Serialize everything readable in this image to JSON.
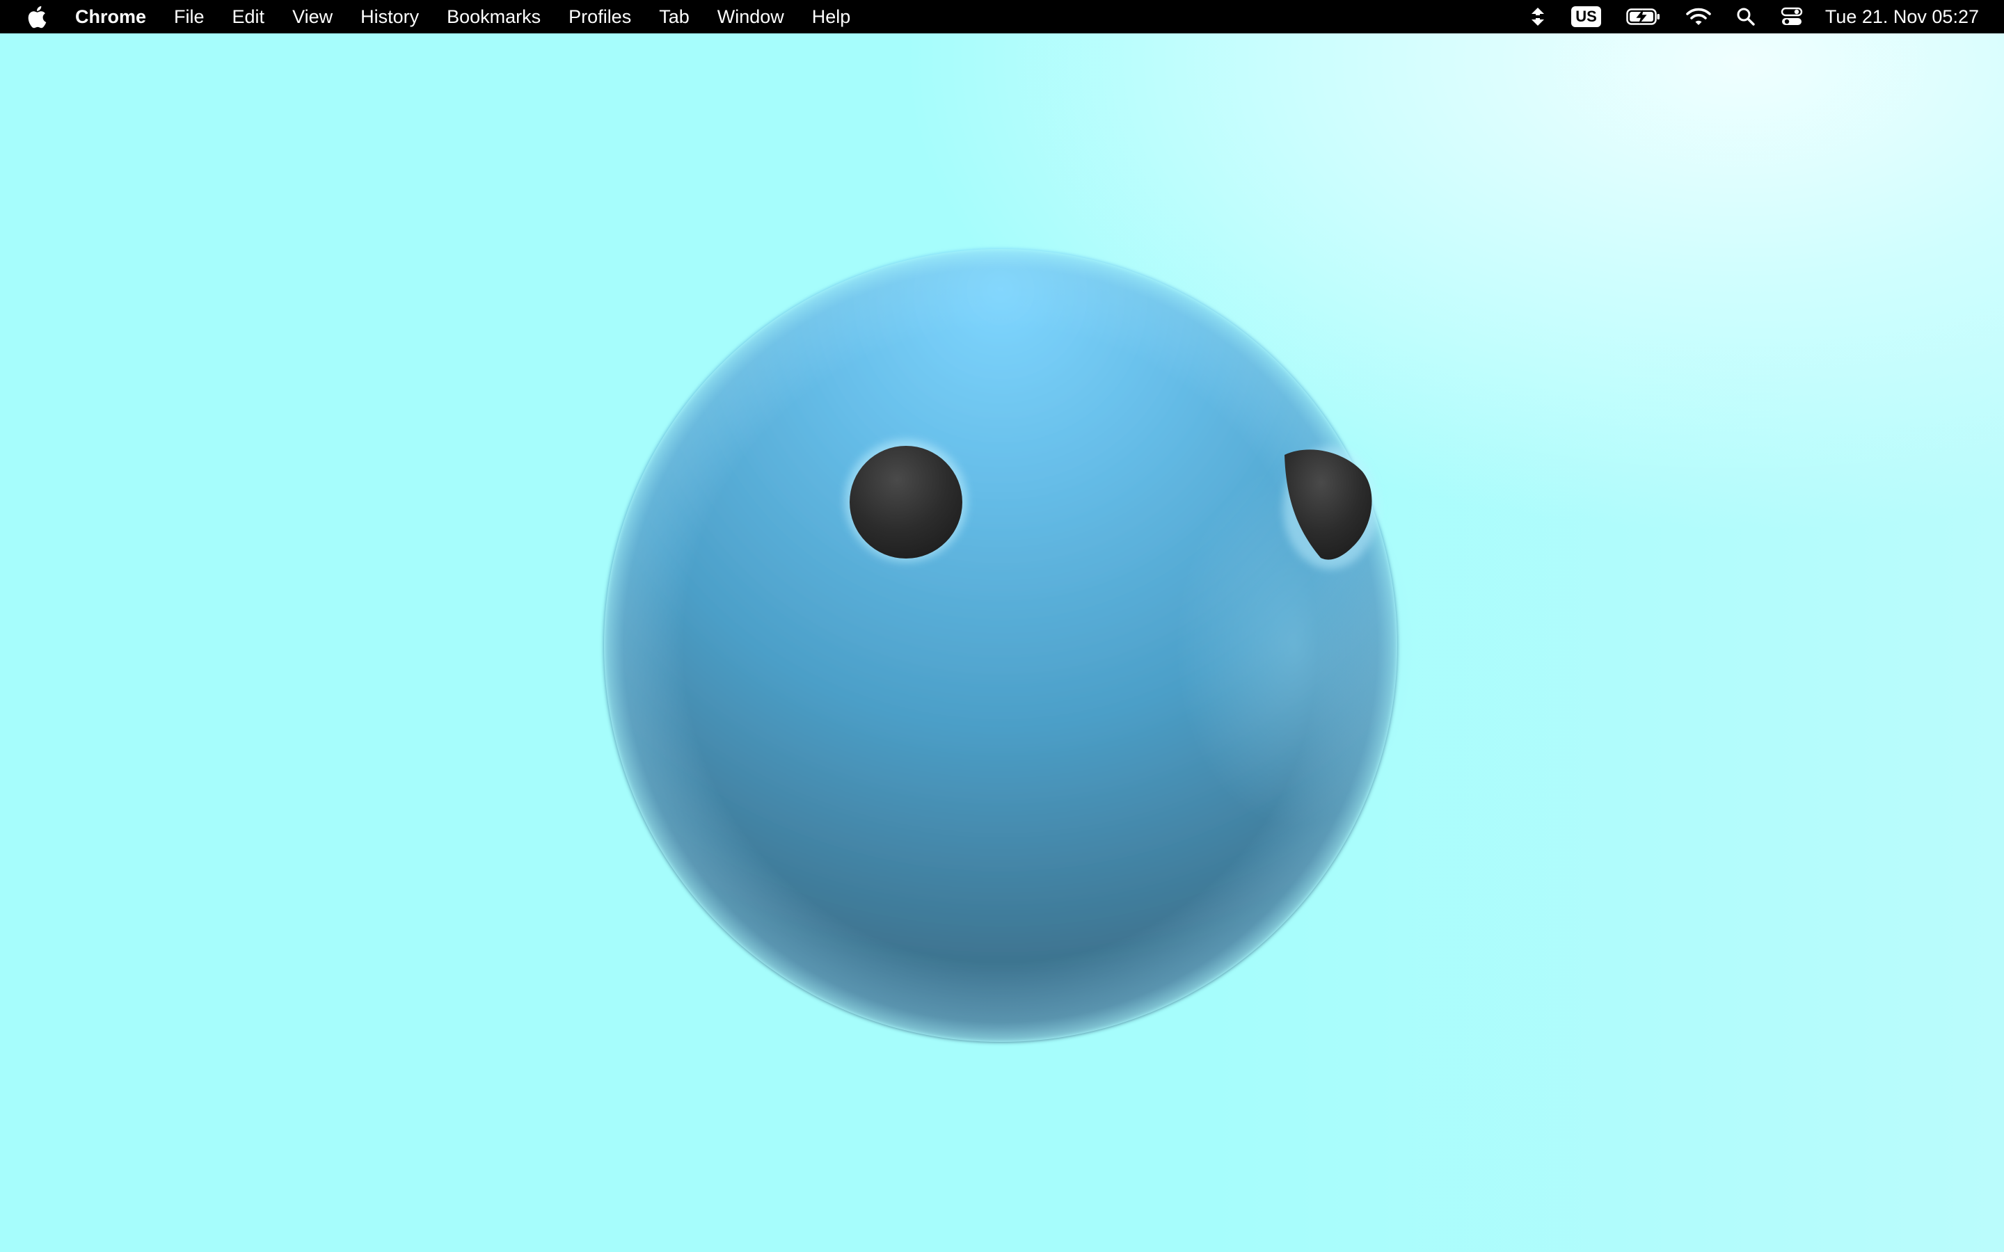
{
  "menubar": {
    "apple_icon": "apple-logo-icon",
    "app_name": "Chrome",
    "menus": [
      "File",
      "Edit",
      "View",
      "History",
      "Bookmarks",
      "Profiles",
      "Tab",
      "Window",
      "Help"
    ],
    "status": {
      "input_source": "US",
      "icons": [
        "arrows-up-down-icon",
        "keyboard-input-icon",
        "battery-charging-icon",
        "wifi-icon",
        "search-icon",
        "control-center-icon"
      ],
      "clock": "Tue 21. Nov  05:27"
    }
  },
  "page": {
    "background_color": "#a6fdfc",
    "character": {
      "name": "blue-sphere-face",
      "body_color": "#5aa9d6",
      "eye_color": "#2a2a2a"
    }
  }
}
